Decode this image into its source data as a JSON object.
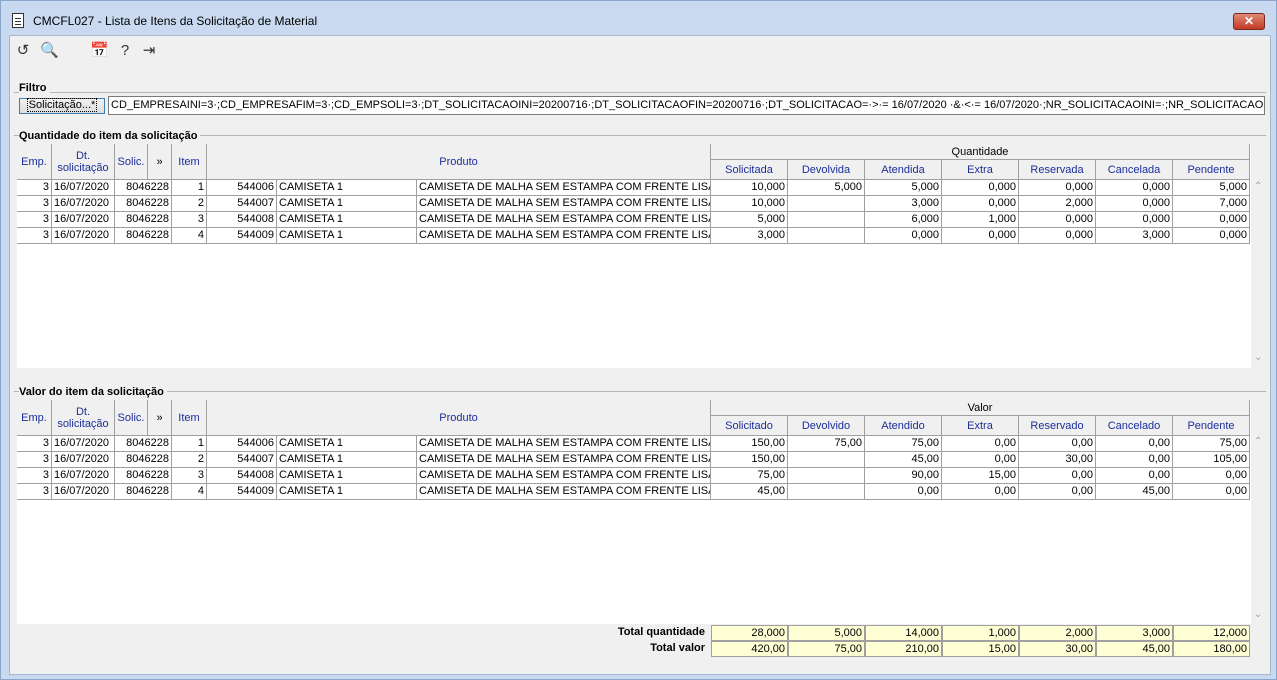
{
  "window": {
    "title": "CMCFL027 - Lista de Itens da Solicitação de Material",
    "close_label": "✕"
  },
  "toolbar": [
    {
      "name": "refresh-icon",
      "glyph": "↺"
    },
    {
      "name": "search-icon",
      "glyph": "🔍"
    },
    {
      "name": "calendar-icon",
      "glyph": "📅"
    },
    {
      "name": "help-icon",
      "glyph": "?"
    },
    {
      "name": "exit-icon",
      "glyph": "⇥"
    }
  ],
  "filter": {
    "title": "Filtro",
    "button_label": "Solicitação...*",
    "value": "CD_EMPRESAINI=3·;CD_EMPRESAFIM=3·;CD_EMPSOLI=3·;DT_SOLICITACAOINI=20200716·;DT_SOLICITACAOFIN=20200716·;DT_SOLICITACAO=·>·= 16/07/2020 ·&·<·= 16/07/2020·;NR_SOLICITACAOINI=·;NR_SOLICITACAOFIN=·;NR_SOLIC"
  },
  "qty_section": {
    "title": "Quantidade do item da solicitação",
    "group_header": "Quantidade",
    "headers": {
      "emp": "Emp.",
      "dt": "Dt. solicitação",
      "solic": "Solic.",
      "more": "»",
      "item": "Item",
      "produto": "Produto"
    },
    "sub_headers": [
      "Solicitada",
      "Devolvida",
      "Atendida",
      "Extra",
      "Reservada",
      "Cancelada",
      "Pendente"
    ],
    "rows": [
      {
        "emp": "3",
        "dt": "16/07/2020",
        "solic": "8046228",
        "item": "1",
        "cod": "544006",
        "nome": "CAMISETA 1",
        "desc": "CAMISETA DE MALHA SEM ESTAMPA COM FRENTE LISA DIV",
        "vals": [
          "10,000",
          "5,000",
          "5,000",
          "0,000",
          "0,000",
          "0,000",
          "5,000"
        ]
      },
      {
        "emp": "3",
        "dt": "16/07/2020",
        "solic": "8046228",
        "item": "2",
        "cod": "544007",
        "nome": "CAMISETA 1",
        "desc": "CAMISETA DE MALHA SEM ESTAMPA COM FRENTE LISA DIV",
        "vals": [
          "10,000",
          "",
          "3,000",
          "0,000",
          "2,000",
          "0,000",
          "7,000"
        ]
      },
      {
        "emp": "3",
        "dt": "16/07/2020",
        "solic": "8046228",
        "item": "3",
        "cod": "544008",
        "nome": "CAMISETA 1",
        "desc": "CAMISETA DE MALHA SEM ESTAMPA COM FRENTE LISA DIV",
        "vals": [
          "5,000",
          "",
          "6,000",
          "1,000",
          "0,000",
          "0,000",
          "0,000"
        ]
      },
      {
        "emp": "3",
        "dt": "16/07/2020",
        "solic": "8046228",
        "item": "4",
        "cod": "544009",
        "nome": "CAMISETA 1",
        "desc": "CAMISETA DE MALHA SEM ESTAMPA COM FRENTE LISA DIV",
        "vals": [
          "3,000",
          "",
          "0,000",
          "0,000",
          "0,000",
          "3,000",
          "0,000"
        ]
      }
    ]
  },
  "val_section": {
    "title": "Valor do item da solicitação",
    "group_header": "Valor",
    "headers": {
      "emp": "Emp.",
      "dt": "Dt. solicitação",
      "solic": "Solic.",
      "more": "»",
      "item": "Item",
      "produto": "Produto"
    },
    "sub_headers": [
      "Solicitado",
      "Devolvido",
      "Atendido",
      "Extra",
      "Reservado",
      "Cancelado",
      "Pendente"
    ],
    "rows": [
      {
        "emp": "3",
        "dt": "16/07/2020",
        "solic": "8046228",
        "item": "1",
        "cod": "544006",
        "nome": "CAMISETA 1",
        "desc": "CAMISETA DE MALHA SEM ESTAMPA COM FRENTE LISA DIV",
        "vals": [
          "150,00",
          "75,00",
          "75,00",
          "0,00",
          "0,00",
          "0,00",
          "75,00"
        ]
      },
      {
        "emp": "3",
        "dt": "16/07/2020",
        "solic": "8046228",
        "item": "2",
        "cod": "544007",
        "nome": "CAMISETA 1",
        "desc": "CAMISETA DE MALHA SEM ESTAMPA COM FRENTE LISA DIV",
        "vals": [
          "150,00",
          "",
          "45,00",
          "0,00",
          "30,00",
          "0,00",
          "105,00"
        ]
      },
      {
        "emp": "3",
        "dt": "16/07/2020",
        "solic": "8046228",
        "item": "3",
        "cod": "544008",
        "nome": "CAMISETA 1",
        "desc": "CAMISETA DE MALHA SEM ESTAMPA COM FRENTE LISA DIV",
        "vals": [
          "75,00",
          "",
          "90,00",
          "15,00",
          "0,00",
          "0,00",
          "0,00"
        ]
      },
      {
        "emp": "3",
        "dt": "16/07/2020",
        "solic": "8046228",
        "item": "4",
        "cod": "544009",
        "nome": "CAMISETA 1",
        "desc": "CAMISETA DE MALHA SEM ESTAMPA COM FRENTE LISA DIV",
        "vals": [
          "45,00",
          "",
          "0,00",
          "0,00",
          "0,00",
          "45,00",
          "0,00"
        ]
      }
    ]
  },
  "totals": {
    "qty_label": "Total quantidade",
    "qty": [
      "28,000",
      "5,000",
      "14,000",
      "1,000",
      "2,000",
      "3,000",
      "12,000"
    ],
    "val_label": "Total valor",
    "val": [
      "420,00",
      "75,00",
      "210,00",
      "15,00",
      "30,00",
      "45,00",
      "180,00"
    ]
  }
}
